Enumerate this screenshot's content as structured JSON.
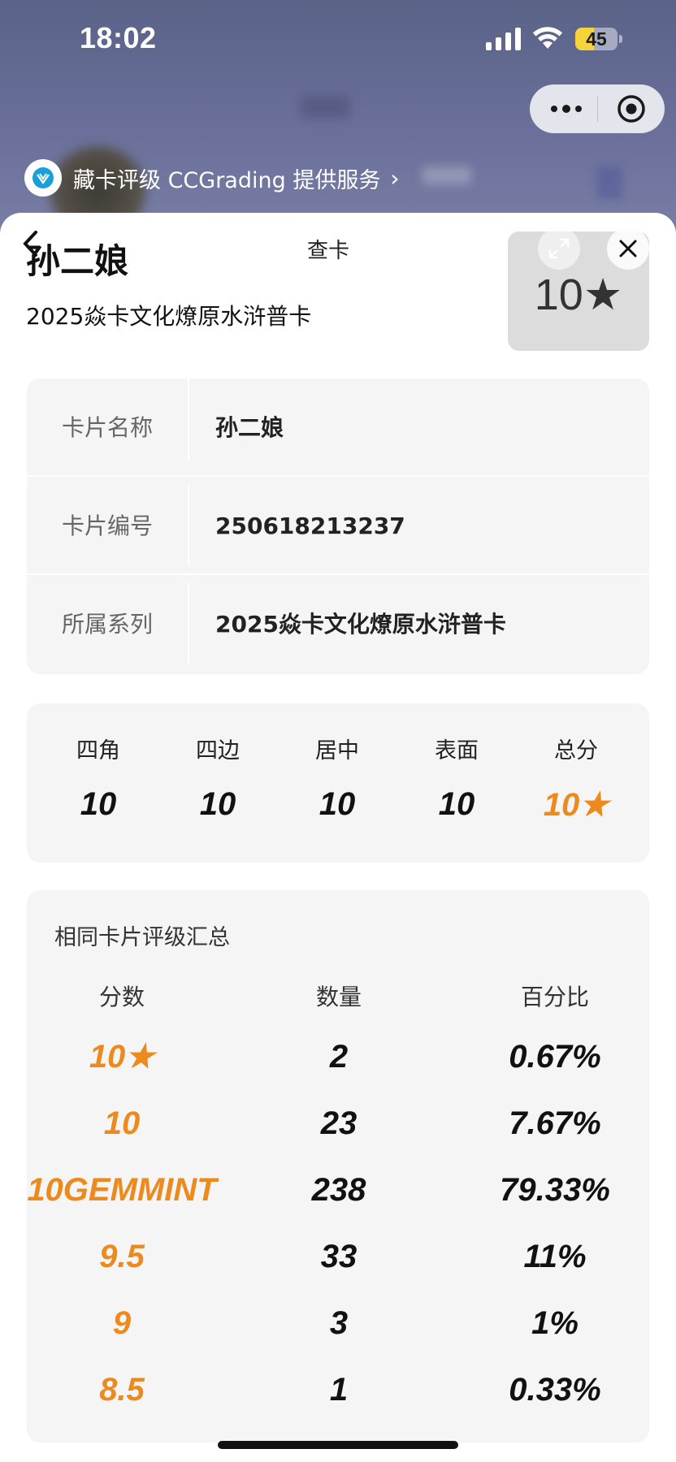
{
  "status_bar": {
    "time": "18:02",
    "battery_level": "45",
    "battery_fraction": 0.45
  },
  "background": {
    "service_text": "藏卡评级 CCGrading 提供服务"
  },
  "sheet": {
    "title": "查卡",
    "card_name": "孙二娘",
    "card_series": "2025焱卡文化燎原水浒普卡",
    "grade": "10★"
  },
  "info": {
    "rows": [
      {
        "label": "卡片名称",
        "value": "孙二娘"
      },
      {
        "label": "卡片编号",
        "value": "250618213237"
      },
      {
        "label": "所属系列",
        "value": "2025焱卡文化燎原水浒普卡"
      }
    ]
  },
  "scores": [
    {
      "label": "四角",
      "value": "10"
    },
    {
      "label": "四边",
      "value": "10"
    },
    {
      "label": "居中",
      "value": "10"
    },
    {
      "label": "表面",
      "value": "10"
    },
    {
      "label": "总分",
      "value": "10★"
    }
  ],
  "summary": {
    "title": "相同卡片评级汇总",
    "headers": [
      "分数",
      "数量",
      "百分比"
    ],
    "rows": [
      {
        "score": "10★",
        "count": "2",
        "percent": "0.67%"
      },
      {
        "score": "10",
        "count": "23",
        "percent": "7.67%"
      },
      {
        "score": "10GEMMINT",
        "count": "238",
        "percent": "79.33%"
      },
      {
        "score": "9.5",
        "count": "33",
        "percent": "11%"
      },
      {
        "score": "9",
        "count": "3",
        "percent": "1%"
      },
      {
        "score": "8.5",
        "count": "1",
        "percent": "0.33%"
      }
    ]
  },
  "colors": {
    "accent": "#ec8a1e",
    "header_bg": "#5b6288",
    "card_bg": "#f5f5f5"
  },
  "icons": {
    "back": "chevron-left-icon",
    "expand": "expand-icon",
    "close": "close-icon",
    "more": "more-dots-icon",
    "target": "target-icon",
    "logo": "ccgrading-logo-icon",
    "signal": "cellular-signal-icon",
    "wifi": "wifi-icon",
    "battery": "battery-icon"
  }
}
